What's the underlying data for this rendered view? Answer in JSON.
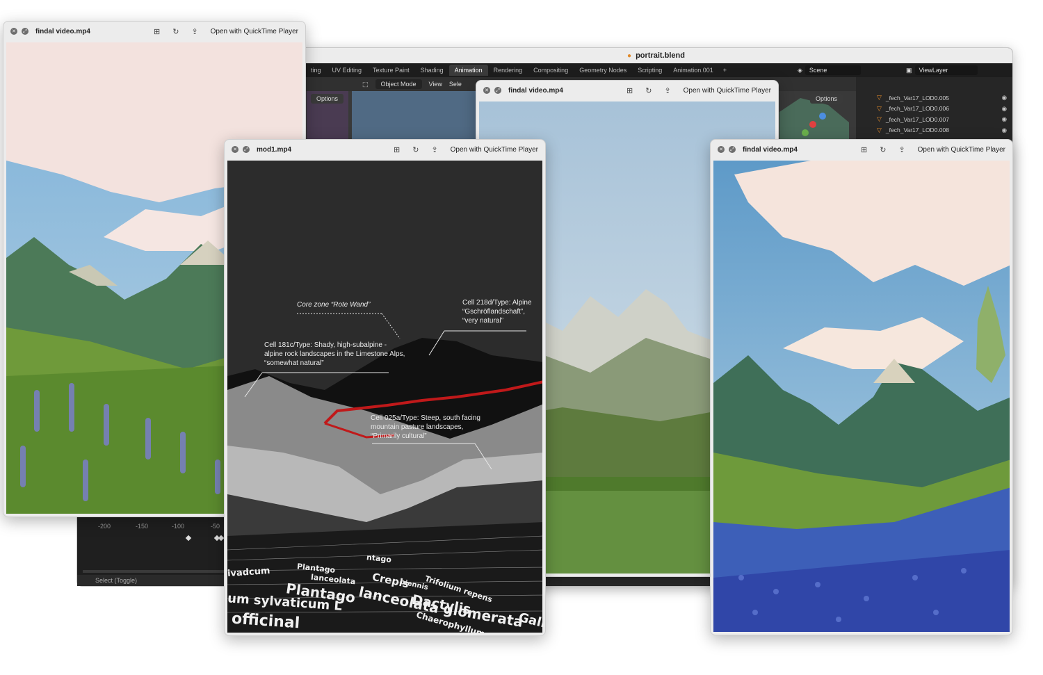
{
  "blender": {
    "title": "portrait.blend",
    "workspace_tabs": [
      "ting",
      "UV Editing",
      "Texture Paint",
      "Shading",
      "Animation",
      "Rendering",
      "Compositing",
      "Geometry Nodes",
      "Scripting",
      "Animation.001"
    ],
    "active_tab": "Animation",
    "add_tab": "+",
    "scene_label": "Scene",
    "view_layer_label": "ViewLayer",
    "mode": "Object Mode",
    "view_menu": "View",
    "select_menu": "Sele",
    "options_label": "Options",
    "outliner_items": [
      "_fech_Var17_LOD0.005",
      "_fech_Var17_LOD0.006",
      "_fech_Var17_LOD0.007",
      "_fech_Var17_LOD0.008"
    ],
    "timeline_ticks": [
      "-200",
      "-150",
      "-100",
      "-50"
    ],
    "status_text": "Select (Toggle)"
  },
  "windows": {
    "left": {
      "title": "findal video.mp4",
      "open_label": "Open with QuickTime Player"
    },
    "middle": {
      "title": "findal video.mp4",
      "open_label": "Open with QuickTime Player"
    },
    "right": {
      "title": "findal video.mp4",
      "open_label": "Open with QuickTime Player"
    },
    "mod1": {
      "title": "mod1.mp4",
      "open_label": "Open with QuickTime Player"
    }
  },
  "mod1_annotations": {
    "core_zone": "Core zone “Rote Wand”",
    "cell_218d": [
      "Cell 218d/Type: Alpine",
      "“Gschröflandschaft”,",
      "“very natural”"
    ],
    "cell_181c": [
      "Cell 181c/Type: Shady, high-subalpine -",
      "alpine rock landscapes in the Limestone Alps,",
      "“somewhat natural”"
    ],
    "cell_025a": [
      "Cell 025a/Type: Steep, south facing",
      "mountain pasture landscapes,",
      "“Primarily cultural”"
    ],
    "species_words": [
      "Plantago",
      "lanceolata",
      "Dactylis",
      "glomerata",
      "Crepis",
      "biennis",
      "um sylvaticum L",
      "officinal",
      "Galium",
      "Trifolium repens",
      "Chaerophyllum",
      "Plantago",
      "lanceolata",
      "ntago",
      "ivadcum"
    ]
  },
  "colors": {
    "blender_bg": "#2b2b2b",
    "accent_orange": "#e08a2a",
    "annotation_red": "#c0191a",
    "window_chrome": "#ececec"
  }
}
